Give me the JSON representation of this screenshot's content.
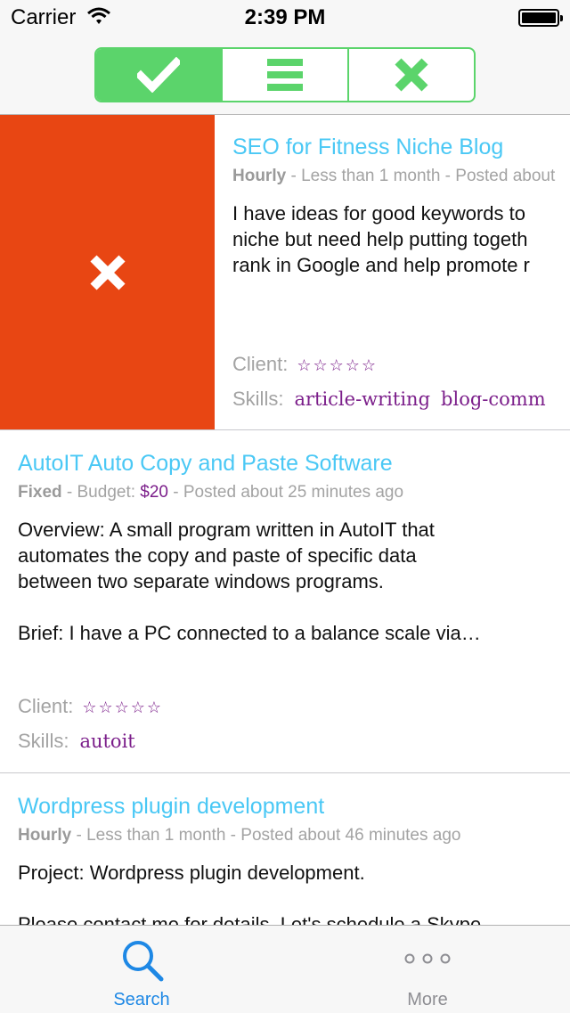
{
  "status_bar": {
    "carrier": "Carrier",
    "time": "2:39 PM"
  },
  "filter": {
    "segments": [
      {
        "name": "accepted",
        "icon": "checkmark-icon",
        "selected": true
      },
      {
        "name": "all",
        "icon": "list-icon",
        "selected": false
      },
      {
        "name": "rejected",
        "icon": "x-icon",
        "selected": false
      }
    ]
  },
  "jobs": [
    {
      "title": "SEO for Fitness Niche Blog",
      "type": "Hourly",
      "budget_prefix": " - Less than 1 month",
      "budget_value": "",
      "posted": " - Posted about",
      "description": "I have ideas for good keywords to\nniche but need help putting togeth\nrank in Google and help promote r",
      "client_label": "Client:",
      "client_rating": "☆☆☆☆☆",
      "skills_label": "Skills:",
      "skills": [
        "article-writing",
        "blog-comm"
      ]
    },
    {
      "title": "AutoIT Auto Copy and Paste Software",
      "type": "Fixed",
      "budget_prefix": " - Budget: ",
      "budget_value": "$20",
      "posted": " - Posted about 25 minutes ago",
      "description": "Overview: A small program written in AutoIT that\nautomates the copy and paste of specific data\nbetween two separate windows programs.\n\nBrief: I have a PC connected to a balance scale via…",
      "client_label": "Client:",
      "client_rating": "☆☆☆☆☆",
      "skills_label": "Skills:",
      "skills": [
        "autoit"
      ]
    },
    {
      "title": "Wordpress plugin development",
      "type": "Hourly",
      "budget_prefix": " - Less than 1 month",
      "budget_value": "",
      "posted": " - Posted about 46 minutes ago",
      "description": "Project: Wordpress plugin development.\n\nPlease contact me for details. Let's schedule a Skype\nmeeting"
    }
  ],
  "swipe_action": {
    "icon": "x-icon",
    "color": "#e84613"
  },
  "tab_bar": {
    "tabs": [
      {
        "label": "Search",
        "icon": "search-icon",
        "selected": true
      },
      {
        "label": "More",
        "icon": "more-icon",
        "selected": false
      }
    ]
  },
  "colors": {
    "accent": "#5bd46b",
    "title": "#4ac8f5",
    "skill": "#7b1e8a",
    "tab_active": "#1e88e5"
  }
}
